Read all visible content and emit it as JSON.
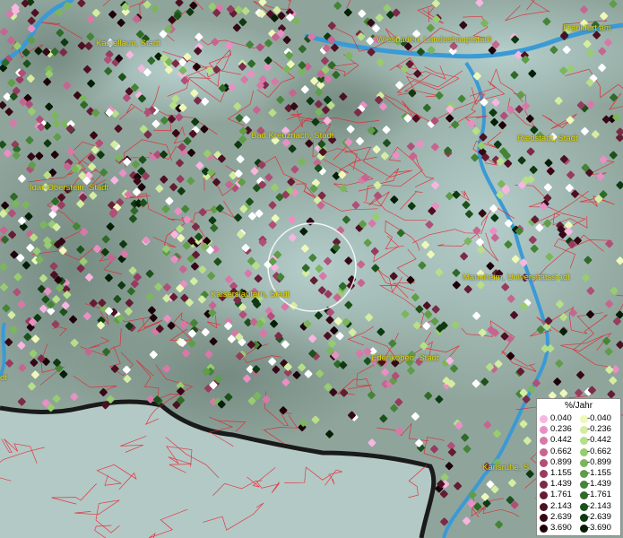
{
  "map": {
    "cities": [
      {
        "name": "Kastellaun, Stadt"
      },
      {
        "name": "Wiesbaden, Landeshauptstadt"
      },
      {
        "name": "Frankfurt am"
      },
      {
        "name": "Bad Kreuznach, Stadt"
      },
      {
        "name": "Riedstadt, Stadt"
      },
      {
        "name": "Idar-Oberstein, Stadt"
      },
      {
        "name": "Mannheim, Universitätsstadt"
      },
      {
        "name": "Kaiserslautern, Stadt"
      },
      {
        "name": "Edenkoben, Stadt"
      },
      {
        "name": "Karlsruhe, S"
      },
      {
        "name": "dt"
      }
    ],
    "legend": {
      "title": "%/Jahr",
      "positive": [
        {
          "label": "0.040",
          "color": "#f7b6df"
        },
        {
          "label": "0.236",
          "color": "#e98fc4"
        },
        {
          "label": "0.442",
          "color": "#d978a8"
        },
        {
          "label": "0.662",
          "color": "#c66690"
        },
        {
          "label": "0.899",
          "color": "#b04f77"
        },
        {
          "label": "1.155",
          "color": "#973c5e"
        },
        {
          "label": "1.439",
          "color": "#7c2a47"
        },
        {
          "label": "1.761",
          "color": "#641c33"
        },
        {
          "label": "2.143",
          "color": "#4d1023"
        },
        {
          "label": "2.639",
          "color": "#360816"
        },
        {
          "label": "3.690",
          "color": "#1e020a"
        }
      ],
      "negative": [
        {
          "label": "-0.040",
          "color": "#eef8b8"
        },
        {
          "label": "-0.236",
          "color": "#d4eda0"
        },
        {
          "label": "-0.442",
          "color": "#b7df88"
        },
        {
          "label": "-0.662",
          "color": "#98cc70"
        },
        {
          "label": "-0.899",
          "color": "#7bb65c"
        },
        {
          "label": "-1.155",
          "color": "#5f9d48"
        },
        {
          "label": "-1.439",
          "color": "#458437"
        },
        {
          "label": "-1.761",
          "color": "#2f6a28"
        },
        {
          "label": "-2.143",
          "color": "#1d511b"
        },
        {
          "label": "-2.639",
          "color": "#0f3910"
        },
        {
          "label": "-3.690",
          "color": "#041f05"
        }
      ]
    },
    "colors": {
      "terrain": "#8da39a",
      "lowland": "#a7c2bf",
      "river": "#3a9ad6",
      "border_lines": "#e8202a",
      "state_border": "#1a1a1a",
      "label_text": "#e8d800"
    }
  }
}
